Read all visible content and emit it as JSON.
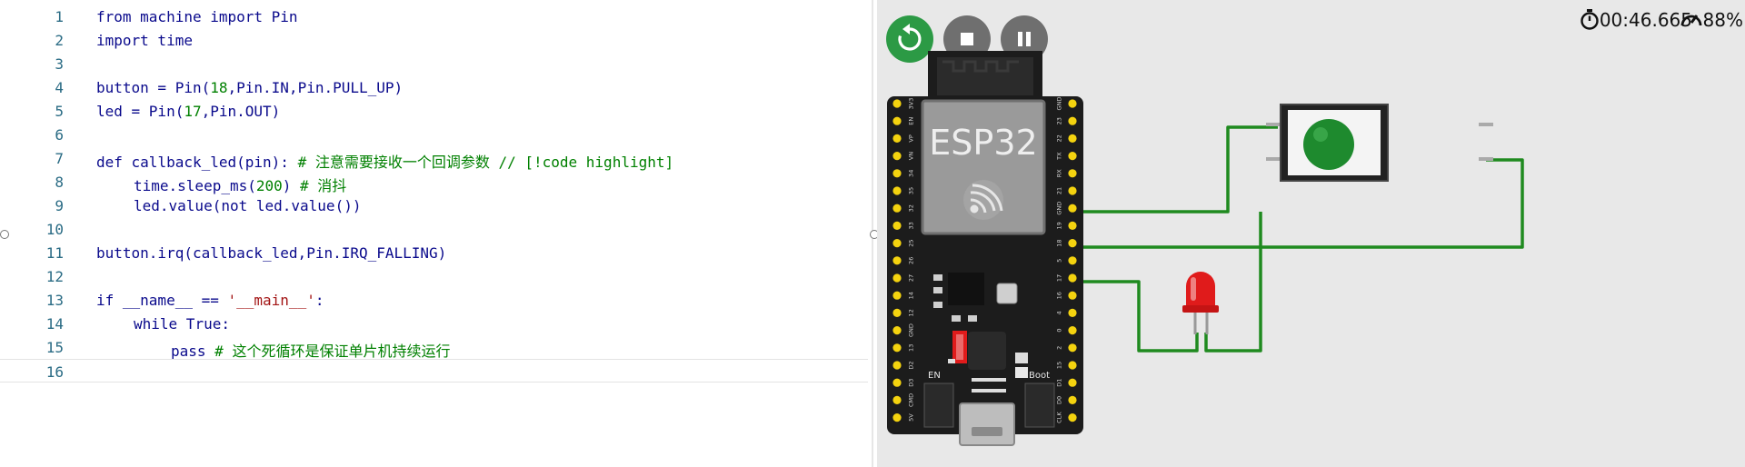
{
  "editor": {
    "lines": [
      {
        "num": "1",
        "indent": 0,
        "tokens": [
          {
            "t": "from",
            "c": "kw"
          },
          {
            "t": " machine "
          },
          {
            "t": "import",
            "c": "kw"
          },
          {
            "t": " Pin"
          }
        ]
      },
      {
        "num": "2",
        "indent": 0,
        "tokens": [
          {
            "t": "import",
            "c": "kw"
          },
          {
            "t": " time"
          }
        ]
      },
      {
        "num": "3",
        "indent": 0,
        "tokens": []
      },
      {
        "num": "4",
        "indent": 0,
        "tokens": [
          {
            "t": "button = Pin("
          },
          {
            "t": "18",
            "c": "num"
          },
          {
            "t": ",Pin.IN,Pin.PULL_UP)"
          }
        ]
      },
      {
        "num": "5",
        "indent": 0,
        "tokens": [
          {
            "t": "led = Pin("
          },
          {
            "t": "17",
            "c": "num"
          },
          {
            "t": ",Pin.OUT)"
          }
        ]
      },
      {
        "num": "6",
        "indent": 0,
        "tokens": []
      },
      {
        "num": "7",
        "indent": 0,
        "tokens": [
          {
            "t": "def",
            "c": "kw"
          },
          {
            "t": " callback_led(pin): "
          },
          {
            "t": "# 注意需要接收一个回调参数 // [!code highlight]",
            "c": "com"
          }
        ]
      },
      {
        "num": "8",
        "indent": 1,
        "tokens": [
          {
            "t": "time.sleep_ms("
          },
          {
            "t": "200",
            "c": "num"
          },
          {
            "t": ") "
          },
          {
            "t": "# 消抖",
            "c": "com"
          }
        ]
      },
      {
        "num": "9",
        "indent": 1,
        "tokens": [
          {
            "t": "led.value("
          },
          {
            "t": "not",
            "c": "kw"
          },
          {
            "t": " led.value())"
          }
        ]
      },
      {
        "num": "10",
        "indent": 0,
        "tokens": []
      },
      {
        "num": "11",
        "indent": 0,
        "tokens": [
          {
            "t": "button.irq(callback_led,Pin.IRQ_FALLING)"
          }
        ]
      },
      {
        "num": "12",
        "indent": 0,
        "tokens": []
      },
      {
        "num": "13",
        "indent": 0,
        "tokens": [
          {
            "t": "if",
            "c": "kw"
          },
          {
            "t": " __name__ == "
          },
          {
            "t": "'__main__'",
            "c": "str"
          },
          {
            "t": ":"
          }
        ]
      },
      {
        "num": "14",
        "indent": 1,
        "tokens": [
          {
            "t": "while",
            "c": "kw"
          },
          {
            "t": " True:"
          }
        ]
      },
      {
        "num": "15",
        "indent": 2,
        "tokens": [
          {
            "t": "pass",
            "c": "kw"
          },
          {
            "t": " "
          },
          {
            "t": "# 这个死循环是保证单片机持续运行",
            "c": "com"
          }
        ]
      },
      {
        "num": "16",
        "indent": 0,
        "tokens": [],
        "active": true
      }
    ]
  },
  "sim": {
    "controls": {
      "restart_icon": "restart-icon",
      "stop_icon": "stop-icon",
      "pause_icon": "pause-icon"
    },
    "timer": "00:46.665",
    "speed": "88%",
    "board": {
      "label": "ESP32",
      "left_pins": [
        "3V3",
        "EN",
        "VP",
        "VN",
        "34",
        "35",
        "32",
        "33",
        "25",
        "26",
        "27",
        "14",
        "12",
        "GND",
        "13",
        "D2",
        "D3",
        "CMD",
        "5V"
      ],
      "right_pins": [
        "GND",
        "23",
        "22",
        "TX",
        "RX",
        "21",
        "GND",
        "19",
        "18",
        "5",
        "17",
        "16",
        "4",
        "0",
        "2",
        "15",
        "D1",
        "D0",
        "CLK"
      ],
      "en_label": "EN",
      "boot_label": "Boot"
    },
    "colors": {
      "wire": "#1f8a1f",
      "board": "#1c1c1c",
      "pin": "#f4d30f",
      "led": "#e01b1b",
      "button_cap": "#1e8a2e",
      "restart_btn": "#2c9a45",
      "ctrl_btn": "#6f6f6f"
    }
  }
}
